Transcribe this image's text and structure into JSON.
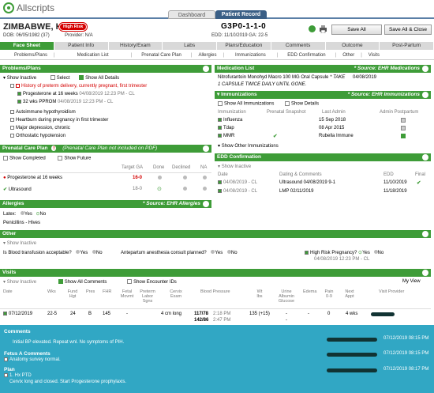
{
  "app": {
    "name": "Allscripts",
    "tabs": [
      "Dashboard",
      "Patient Record"
    ]
  },
  "patient": {
    "name": "ZIMBABWE, Hara",
    "risk_badge": "High Risk",
    "dob": "DOB: 06/05/1982 (37)",
    "provider": "Provider: N/A",
    "gp": "G3P0-1-1-0",
    "edd": "EDD: 11/10/2019 GA: 22-5"
  },
  "buttons": {
    "save_all": "Save All",
    "save_close": "Save All & Close"
  },
  "nav": [
    "Face Sheet",
    "Patient Info",
    "History/Exam",
    "Labs",
    "Plans/Education",
    "Comments",
    "Outcome",
    "Post-Partum"
  ],
  "subnav": [
    "Problems/Plans",
    "Medication List",
    "Prenatal Care Plan",
    "Allergies",
    "Immunizations",
    "EDD Confirmation",
    "Other",
    "Visits"
  ],
  "problems": {
    "title": "Problems/Plans",
    "show_inactive": "Show Inactive",
    "select": "Select",
    "show_all_details": "Show All Details",
    "items": [
      "History of preterm delivery, currently pregnant, first trimester",
      "Progesterone at 16 weeks",
      "32 wks PPROM",
      "Autoimmune hypothyroidism",
      "Heartburn during pregnancy in first trimester",
      "Major depression, chronic",
      "Orthostatic hypotension"
    ],
    "sub1_date": "04/08/2019 12:23 PM - CL",
    "sub2_date": "04/08/2019 12:23 PM - CL"
  },
  "prenatal": {
    "title": "Prenatal Care Plan",
    "note": "(Prenatal Care Plan not included on PDF)",
    "show_completed": "Show Completed",
    "show_future": "Show Future",
    "cols": [
      "Target GA",
      "Done",
      "Declined",
      "NA"
    ],
    "rows": [
      {
        "name": "Progesterone at 16 weeks",
        "ga": "16-0"
      },
      {
        "name": "Ultrasound",
        "ga": "18-0"
      }
    ]
  },
  "allergies": {
    "title": "Allergies",
    "source": "* Source: EHR Allergies",
    "latex": "Latex:",
    "yes": "Yes",
    "no": "No",
    "list": "Penicillins - Hives"
  },
  "medication": {
    "title": "Medication List",
    "source": "* Source: EHR Medications",
    "line1": "Nitrofurantoin Monohyd Macro 100 MG Oral Capsule",
    "line1b": "* TAKE",
    "line1c": "04/08/2019",
    "line2": "1 CAPSULE TWICE DAILY UNTIL GONE."
  },
  "immunizations": {
    "title": "Immunizations",
    "source": "* Source: EHR Immunizations",
    "show_all": "Show All Immunizations",
    "show_details": "Show Details",
    "cols": [
      "Immunization",
      "Prenatal Snapshot",
      "Last Admin",
      "Admin Postpartum"
    ],
    "rows": [
      {
        "name": "Influenza",
        "date": "15 Sep 2018"
      },
      {
        "name": "Tdap",
        "date": "08 Apr 2015"
      },
      {
        "name": "MMR",
        "date": "Rubella Immune"
      }
    ],
    "show_other": "Show Other Immunizations"
  },
  "edd_conf": {
    "title": "EDD Confirmation",
    "show_inactive": "Show Inactive",
    "cols": [
      "Date",
      "Dating & Comments",
      "EDD",
      "Final"
    ],
    "rows": [
      {
        "date": "04/08/2019 - CL",
        "comment": "Ultrasound 04/08/2019 9-1",
        "edd": "11/10/2019"
      },
      {
        "date": "04/08/2019 - CL",
        "comment": "LMP 02/11/2019",
        "edd": "11/18/2019"
      }
    ]
  },
  "other": {
    "title": "Other",
    "show_inactive": "Show Inactive",
    "q1": "Is Blood transfusion acceptable?",
    "q2": "Antepartum anesthesia consult planned?",
    "q3": "High Risk Pregnancy?",
    "yes": "Yes",
    "no": "No",
    "q3_date": "04/08/2019 12:23 PM - CL"
  },
  "visits": {
    "title": "Visits",
    "show_inactive": "Show Inactive",
    "show_all_comments": "Show All Comments",
    "show_encounter": "Show Encounter IDs",
    "my_view": "My View",
    "cols": [
      "Date",
      "Wks",
      "Fund Hgt",
      "Pres",
      "FHR",
      "Fetal Movmt",
      "Preterm Labor Sgns",
      "Cervix Exam",
      "Blood Pressure",
      "Wt lbs",
      "Urine Albumin Glucose",
      "Edema",
      "Pain 0-9",
      "Next Appt",
      "Visit Provider"
    ],
    "row": {
      "date": "07/12/2019",
      "wks": "22-5",
      "fund": "24",
      "pres": "B",
      "fhr": "145",
      "fetal": "-",
      "cervix": "4 cm long",
      "bp1": "117/78",
      "bp1t": "2:18 PM",
      "bp2": "142/86",
      "bp2t": "2:47 PM",
      "wt": "135 (+15)",
      "urine": "-",
      "urine2": "-",
      "edema": "-",
      "pain": "0",
      "next": "4 wks"
    }
  },
  "comments": {
    "title": "Comments",
    "c1": "Initial BP elevated. Repeat wnl. No symptoms of PIH.",
    "c1_date": "07/12/2019 08:15 PM",
    "fetus_title": "Fetus A Comments",
    "c2": "Anatomy survey normal.",
    "c2_date": "07/12/2019 08:15 PM",
    "plan_title": "Plan",
    "c3a": "1. Hx PTD",
    "c3b": "Cervix long and closed. Start Progesterone prophylaxis.",
    "c3_date": "07/12/2019 08:17 PM"
  },
  "colors": {
    "green": "#3e9c38",
    "navy": "#3a5f86",
    "teal": "#31a7c4",
    "red": "#d40000"
  }
}
